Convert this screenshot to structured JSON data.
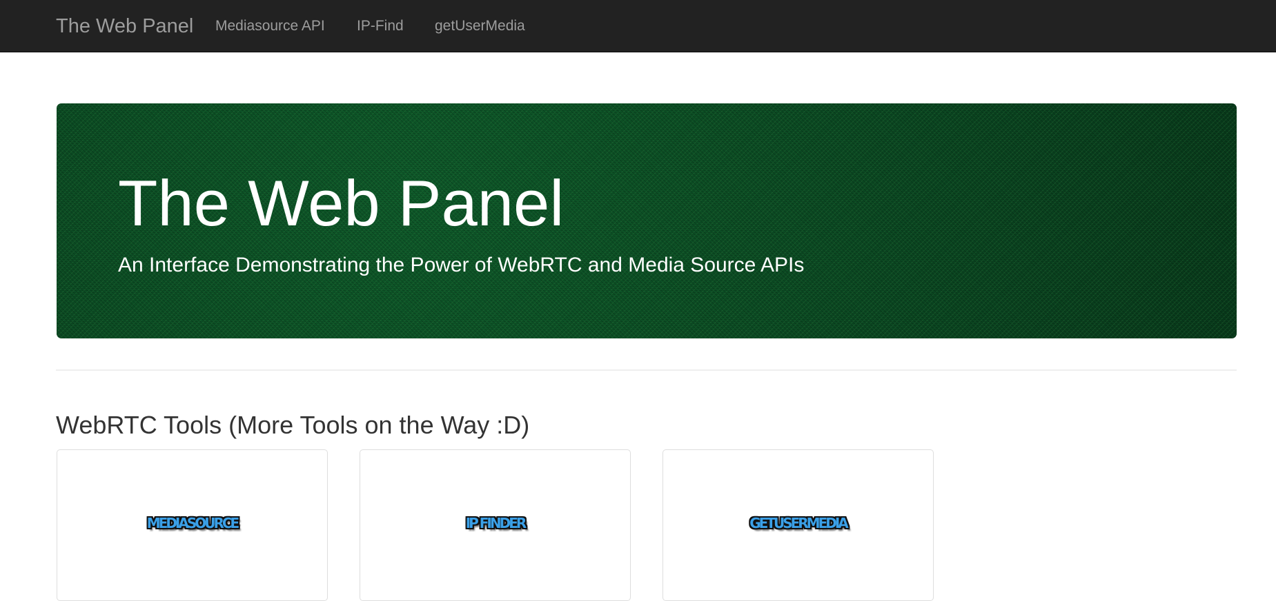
{
  "navbar": {
    "brand": "The Web Panel",
    "links": [
      {
        "label": "Mediasource API"
      },
      {
        "label": "IP-Find"
      },
      {
        "label": "getUserMedia"
      }
    ],
    "background_color": "#222222",
    "link_color": "#9d9d9d"
  },
  "jumbotron": {
    "title": "The Web Panel",
    "subtitle": "An Interface Demonstrating the Power of WebRTC and Media Source APIs",
    "background_color": "#0b4a22"
  },
  "tools_section": {
    "heading": "WebRTC Tools (More Tools on the Way :D)",
    "cards": [
      {
        "logo_text": "MEDIASOURCE"
      },
      {
        "logo_text": "IP FINDER"
      },
      {
        "logo_text": "GETUSERMEDIA"
      }
    ],
    "logo_color": "#3aa0e8"
  }
}
